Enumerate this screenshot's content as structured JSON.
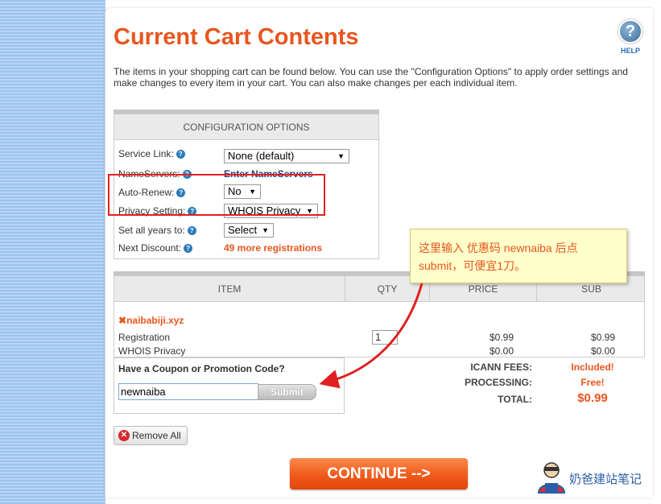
{
  "page": {
    "title": "Current Cart Contents",
    "help_label": "HELP",
    "intro": "The items in your shopping cart can be found below. You can use the \"Configuration Options\" to apply order settings and make changes to every item in your cart. You can also make changes per each individual item."
  },
  "config": {
    "header": "CONFIGURATION OPTIONS",
    "service_link_label": "Service Link:",
    "service_link_value": "None (default)",
    "nameservers_label": "NameServers:",
    "nameservers_link": "Enter NameServers",
    "auto_renew_label": "Auto-Renew:",
    "auto_renew_value": "No",
    "privacy_label": "Privacy Setting:",
    "privacy_value": "WHOIS Privacy",
    "set_years_label": "Set all years to:",
    "set_years_value": "Select",
    "next_discount_label": "Next Discount:",
    "next_discount_value": "49 more registrations"
  },
  "items_table": {
    "headers": {
      "item": "ITEM",
      "qty": "QTY",
      "price": "PRICE",
      "sub": "SUB"
    },
    "domain": "naibabiji.xyz",
    "rows": [
      {
        "name": "Registration",
        "price": "$0.99",
        "sub": "$0.99"
      },
      {
        "name": "WHOIS Privacy",
        "price": "$0.00",
        "sub": "$0.00"
      }
    ],
    "qty": "1"
  },
  "coupon": {
    "question": "Have a Coupon or Promotion Code?",
    "value": "newnaiba",
    "submit": "Submit"
  },
  "totals": {
    "icann_label": "ICANN FEES:",
    "icann_value": "Included!",
    "processing_label": "PROCESSING:",
    "processing_value": "Free!",
    "total_label": "TOTAL:",
    "total_value": "$0.99"
  },
  "remove_all": "Remove All",
  "continue": "CONTINUE -->",
  "annotation": {
    "text": "这里输入 优惠码 newnaiba 后点 submit，可便宜1刀。",
    "color": "#e8561e"
  },
  "watermark": "奶爸建站笔记",
  "colors": {
    "accent": "#e8561e",
    "link": "#22427a",
    "highlight_box": "#e02020"
  }
}
